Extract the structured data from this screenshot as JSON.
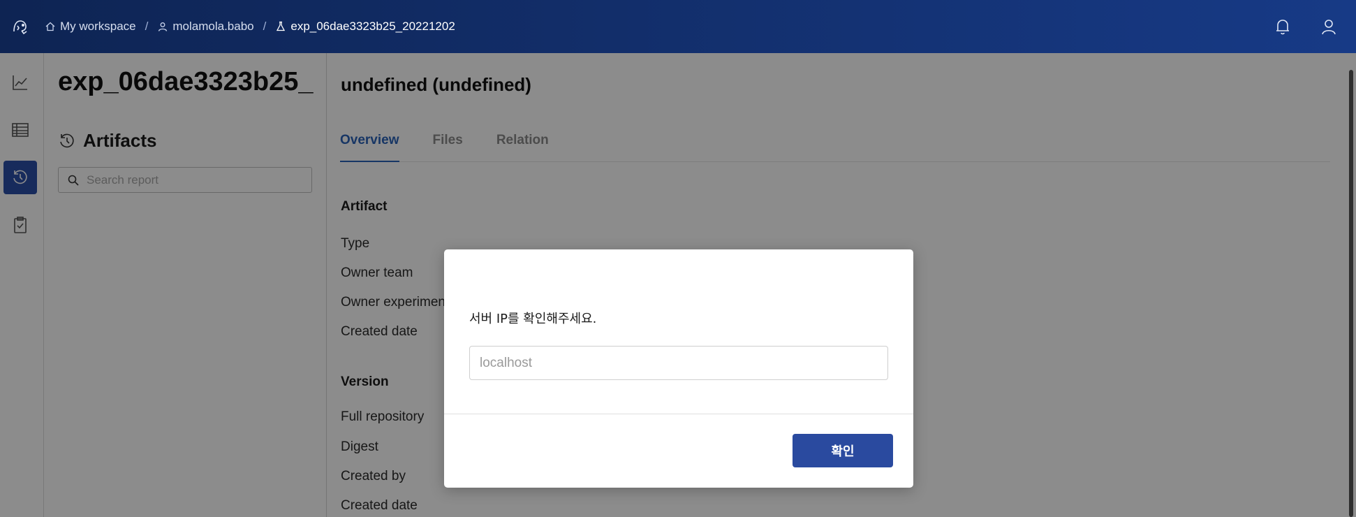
{
  "topbar": {
    "breadcrumbs": [
      {
        "label": "My workspace",
        "icon": "home-icon"
      },
      {
        "label": "molamola.babo",
        "icon": "user-icon"
      },
      {
        "label": "exp_06dae3323b25_20221202",
        "icon": "flask-icon"
      }
    ],
    "separator": "/",
    "icons": [
      "bell-icon",
      "user-icon"
    ]
  },
  "rail": {
    "items": [
      {
        "icon": "chart-line-icon",
        "active": false
      },
      {
        "icon": "table-icon",
        "active": false
      },
      {
        "icon": "history-icon",
        "active": true
      },
      {
        "icon": "clipboard-check-icon",
        "active": false
      }
    ]
  },
  "left_panel": {
    "title": "exp_06dae3323b25_",
    "section_label": "Artifacts",
    "search_placeholder": "Search report"
  },
  "main": {
    "title": "undefined (undefined)",
    "tabs": [
      {
        "label": "Overview",
        "active": true
      },
      {
        "label": "Files",
        "active": false
      },
      {
        "label": "Relation",
        "active": false
      }
    ],
    "artifact_section": {
      "heading": "Artifact",
      "fields": [
        "Type",
        "Owner team",
        "Owner experiment",
        "Created date"
      ]
    },
    "version_section": {
      "heading": "Version",
      "fields": [
        "Full repository",
        "Digest",
        "Created by",
        "Created date"
      ]
    }
  },
  "modal": {
    "message": "서버 IP를 확인해주세요.",
    "input_placeholder": "localhost",
    "confirm_label": "확인",
    "accent_color": "#2a4a9f"
  }
}
